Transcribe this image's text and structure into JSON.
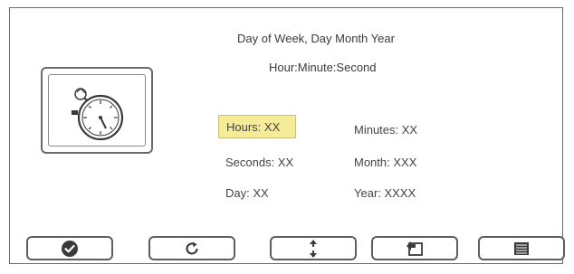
{
  "header": {
    "date_format": "Day of Week, Day Month Year",
    "time_format": "Hour:Minute:Second"
  },
  "fields": {
    "hours": "Hours: XX",
    "minutes": "Minutes: XX",
    "seconds": "Seconds: XX",
    "month": "Month: XXX",
    "day": "Day: XX",
    "year": "Year: XXXX"
  },
  "selected_field": "hours",
  "icons": {
    "main": "stopwatch-icon",
    "buttons": [
      "checkmark-icon",
      "refresh-icon",
      "up-down-arrows-icon",
      "return-icon",
      "menu-list-icon"
    ]
  },
  "colors": {
    "selected_highlight": "#f6ec97",
    "border": "#6a6a6a",
    "icon_dark": "#3a3a3a"
  }
}
